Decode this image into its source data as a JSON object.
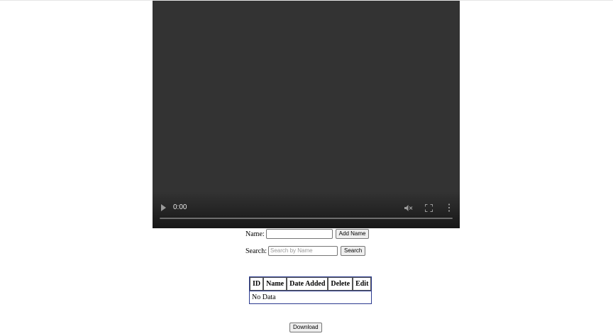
{
  "video": {
    "time": "0:00"
  },
  "form": {
    "name_label": "Name:",
    "add_button": "Add Name",
    "search_label": "Search:",
    "search_placeholder": "Search by Name",
    "search_button": "Search"
  },
  "table": {
    "headers": [
      "ID",
      "Name",
      "Date Added",
      "Delete",
      "Edit"
    ],
    "empty_text": "No Data"
  },
  "footer": {
    "download_button": "Download"
  }
}
